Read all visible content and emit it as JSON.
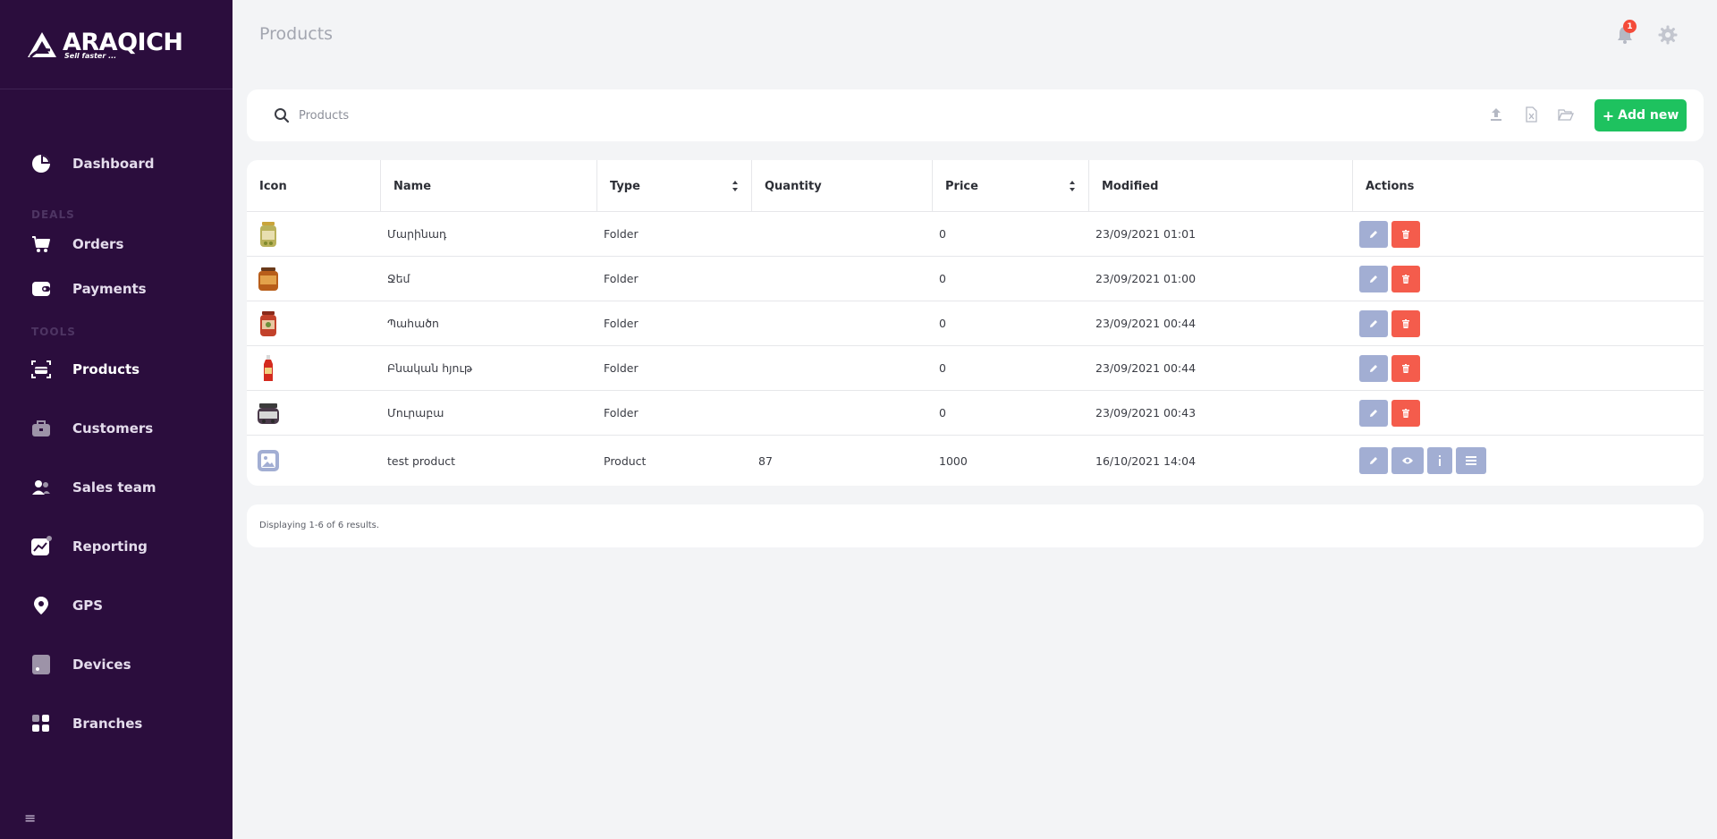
{
  "brand": {
    "name": "ARAQICH",
    "tagline": "Sell faster ..."
  },
  "colors": {
    "sidebar": "#2b0d3d",
    "accent_green": "#1ec25f",
    "edit": "#a2aed3",
    "delete": "#f45c4c",
    "badge": "#f44b3a"
  },
  "sidebar": {
    "items": [
      {
        "label": "Dashboard",
        "icon": "pie-chart-icon"
      },
      {
        "label": "Orders",
        "icon": "cart-icon"
      },
      {
        "label": "Payments",
        "icon": "wallet-icon"
      },
      {
        "label": "Products",
        "icon": "scan-product-icon",
        "active": true
      },
      {
        "label": "Customers",
        "icon": "briefcase-icon"
      },
      {
        "label": "Sales team",
        "icon": "users-icon"
      },
      {
        "label": "Reporting",
        "icon": "chart-line-icon"
      },
      {
        "label": "GPS",
        "icon": "map-pin-icon"
      },
      {
        "label": "Devices",
        "icon": "tablet-icon"
      },
      {
        "label": "Branches",
        "icon": "grid-icon"
      }
    ],
    "sections": {
      "deals": "DEALS",
      "tools": "TOOLS"
    },
    "menu_toggle": "≡"
  },
  "header": {
    "title": "Products",
    "notification_count": "1"
  },
  "search": {
    "placeholder": "Products",
    "value": ""
  },
  "toolbar": {
    "add_label": "Add new",
    "add_plus": "+"
  },
  "table": {
    "columns": [
      "Icon",
      "Name",
      "Type",
      "Quantity",
      "Price",
      "Modified",
      "Actions"
    ],
    "rows": [
      {
        "name": "Մարինադ",
        "type": "Folder",
        "quantity": "",
        "price": "0",
        "modified": "23/09/2021 01:01",
        "thumb": "jar-pickles"
      },
      {
        "name": "Ջեմ",
        "type": "Folder",
        "quantity": "",
        "price": "0",
        "modified": "23/09/2021 01:00",
        "thumb": "jar-jam"
      },
      {
        "name": "Պահածո",
        "type": "Folder",
        "quantity": "",
        "price": "0",
        "modified": "23/09/2021 00:44",
        "thumb": "jar-preserve"
      },
      {
        "name": "Բնական հյութ",
        "type": "Folder",
        "quantity": "",
        "price": "0",
        "modified": "23/09/2021 00:44",
        "thumb": "bottle-juice"
      },
      {
        "name": "Մուրաբա",
        "type": "Folder",
        "quantity": "",
        "price": "0",
        "modified": "23/09/2021 00:43",
        "thumb": "jar-murabba"
      },
      {
        "name": "test product",
        "type": "Product",
        "quantity": "87",
        "price": "1000",
        "modified": "16/10/2021 14:04",
        "thumb": "image-placeholder"
      }
    ]
  },
  "footer": {
    "summary": "Displaying 1-6 of 6 results."
  }
}
